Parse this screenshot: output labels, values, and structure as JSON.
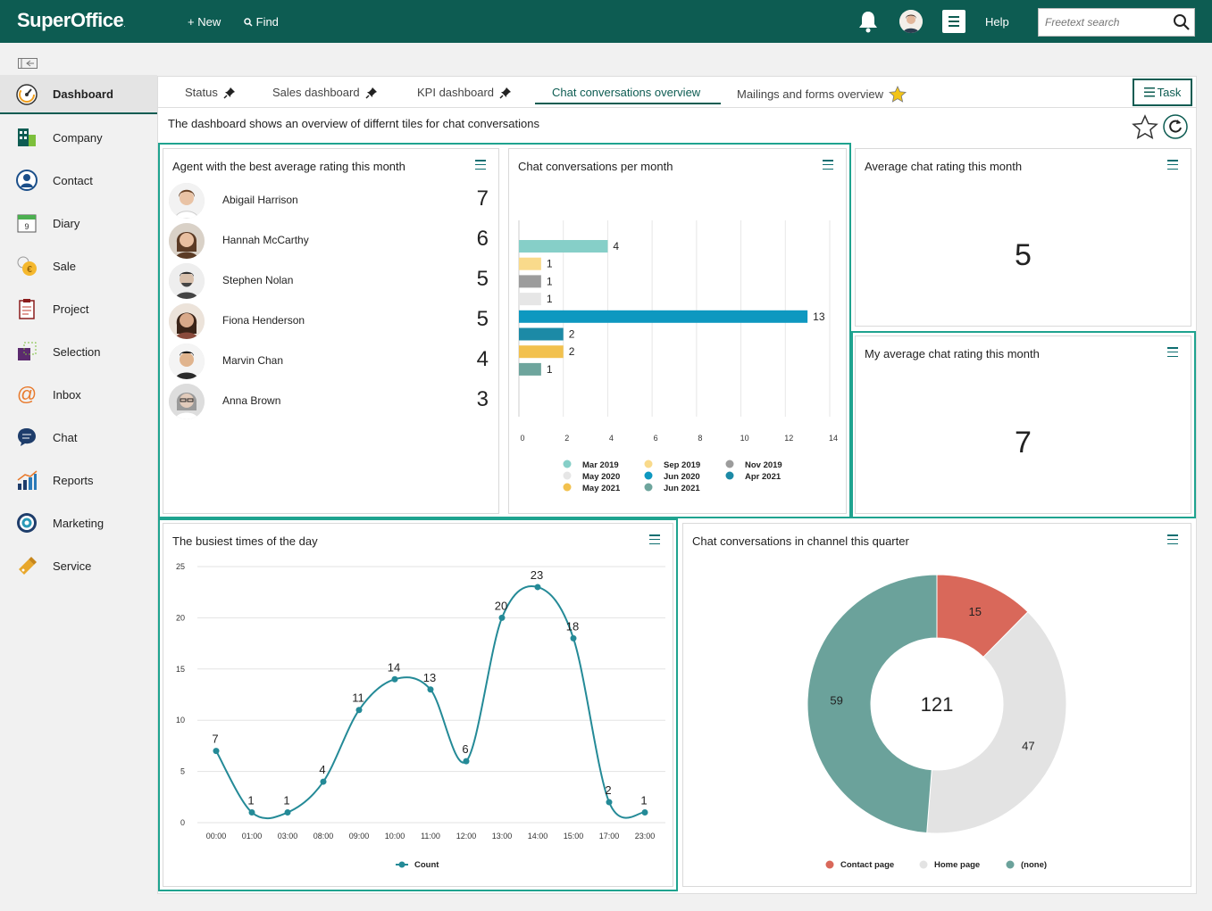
{
  "topbar": {
    "logo": "SuperOffice",
    "logo_mark": ".",
    "new_label": "New",
    "find_label": "Find",
    "help_label": "Help",
    "search_placeholder": "Freetext search",
    "brand_color": "#0d5c52"
  },
  "sidebar": {
    "items": [
      {
        "label": "Dashboard",
        "icon": "dashboard-icon",
        "active": true
      },
      {
        "label": "Company",
        "icon": "company-icon"
      },
      {
        "label": "Contact",
        "icon": "contact-icon"
      },
      {
        "label": "Diary",
        "icon": "diary-icon",
        "badge": "9"
      },
      {
        "label": "Sale",
        "icon": "sale-icon"
      },
      {
        "label": "Project",
        "icon": "project-icon"
      },
      {
        "label": "Selection",
        "icon": "selection-icon"
      },
      {
        "label": "Inbox",
        "icon": "inbox-icon"
      },
      {
        "label": "Chat",
        "icon": "chat-icon"
      },
      {
        "label": "Reports",
        "icon": "reports-icon"
      },
      {
        "label": "Marketing",
        "icon": "marketing-icon"
      },
      {
        "label": "Service",
        "icon": "service-icon"
      }
    ]
  },
  "tabs": [
    {
      "label": "Status",
      "icon": "pin-icon"
    },
    {
      "label": "Sales dashboard",
      "icon": "pin-icon"
    },
    {
      "label": "KPI dashboard",
      "icon": "pin-icon"
    },
    {
      "label": "Chat conversations overview",
      "active": true
    },
    {
      "label": "Mailings and forms overview",
      "icon": "star-icon"
    }
  ],
  "task_label": "Task",
  "description": "The dashboard shows an overview of differnt tiles for chat conversations",
  "tiles": {
    "agents": {
      "title": "Agent with the best average rating this month",
      "rows": [
        {
          "name": "Abigail Harrison",
          "score": "7"
        },
        {
          "name": "Hannah McCarthy",
          "score": "6"
        },
        {
          "name": "Stephen Nolan",
          "score": "5"
        },
        {
          "name": "Fiona Henderson",
          "score": "5"
        },
        {
          "name": "Marvin Chan",
          "score": "4"
        },
        {
          "name": "Anna Brown",
          "score": "3"
        }
      ]
    },
    "per_month": {
      "title": "Chat conversations per month"
    },
    "avg_rating": {
      "title": "Average chat rating this month",
      "value": "5"
    },
    "my_rating": {
      "title": "My average chat rating this month",
      "value": "7"
    },
    "busiest": {
      "title": "The busiest times of the day"
    },
    "channel": {
      "title": "Chat conversations in channel this quarter",
      "total": "121"
    }
  },
  "chart_data": [
    {
      "type": "bar",
      "orientation": "horizontal",
      "categories": [
        "Mar 2019",
        "Sep 2019",
        "Nov 2019",
        "May 2020",
        "Jun 2020",
        "Apr 2021",
        "May 2021",
        "Jun 2021"
      ],
      "values": [
        4,
        1,
        1,
        1,
        13,
        2,
        2,
        1
      ],
      "colors": [
        "#86cfc8",
        "#f9da8b",
        "#9c9c9c",
        "#e6e6e6",
        "#0e98c0",
        "#1c8aa6",
        "#f2c14e",
        "#6ea59d"
      ],
      "xlim": [
        0,
        14
      ],
      "xticks": [
        0,
        2,
        4,
        6,
        8,
        10,
        12,
        14
      ],
      "legend": "bottom"
    },
    {
      "type": "line",
      "series": [
        {
          "name": "Count",
          "color": "#248a97",
          "values": [
            7,
            1,
            1,
            4,
            11,
            14,
            13,
            6,
            20,
            23,
            18,
            2,
            1
          ]
        }
      ],
      "x": [
        "00:00",
        "01:00",
        "03:00",
        "08:00",
        "09:00",
        "10:00",
        "11:00",
        "12:00",
        "13:00",
        "14:00",
        "15:00",
        "17:00",
        "23:00"
      ],
      "ylim": [
        0,
        25
      ],
      "yticks": [
        0,
        5,
        10,
        15,
        20,
        25
      ],
      "grid": "horizontal",
      "legend": "bottom"
    },
    {
      "type": "pie",
      "donut": true,
      "center_label": "121",
      "categories": [
        "Contact page",
        "Home page",
        "(none)"
      ],
      "values": [
        15,
        47,
        59
      ],
      "colors": [
        "#d9685a",
        "#e3e3e3",
        "#6ba29b"
      ],
      "legend": "bottom"
    }
  ]
}
